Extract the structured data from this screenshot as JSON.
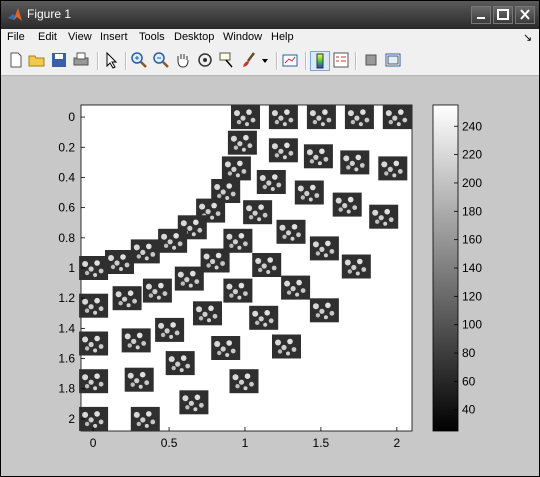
{
  "window": {
    "title": "Figure 1"
  },
  "menu": {
    "items": [
      "File",
      "Edit",
      "View",
      "Insert",
      "Tools",
      "Desktop",
      "Window",
      "Help"
    ],
    "arrow": "↘"
  },
  "toolbar": {
    "icons": [
      "new-figure-icon",
      "open-file-icon",
      "save-icon",
      "print-icon",
      "select-pointer-icon",
      "zoom-in-icon",
      "zoom-out-icon",
      "pan-hand-icon",
      "rotate-3d-icon",
      "data-cursor-icon",
      "brush-icon",
      "brush-dropdown-icon",
      "link-plot-icon",
      "colorbar-icon",
      "legend-icon",
      "hide-plot-tools-icon",
      "show-plot-tools-icon"
    ]
  },
  "axes": {
    "xticks": [
      "0",
      "0.5",
      "1",
      "1.5",
      "2"
    ],
    "yticks": [
      "0",
      "0.2",
      "0.4",
      "0.6",
      "0.8",
      "1",
      "1.2",
      "1.4",
      "1.6",
      "1.8",
      "2"
    ],
    "xlim": [
      -0.08,
      2.1
    ],
    "ylim": [
      -0.08,
      2.08
    ],
    "y_reversed": true
  },
  "colorbar": {
    "ticks": [
      "240",
      "220",
      "200",
      "180",
      "160",
      "140",
      "120",
      "100",
      "80",
      "60",
      "40"
    ],
    "values": [
      240,
      220,
      200,
      180,
      160,
      140,
      120,
      100,
      80,
      60,
      40
    ],
    "range": [
      25,
      255
    ],
    "colormap": "gray"
  },
  "chart_data": {
    "type": "scatter",
    "description_of_marks": "image thumbnails",
    "points": [
      {
        "x": 1.0,
        "y": 0.0
      },
      {
        "x": 1.25,
        "y": 0.0
      },
      {
        "x": 1.5,
        "y": 0.0
      },
      {
        "x": 1.75,
        "y": 0.0
      },
      {
        "x": 2.0,
        "y": 0.0
      },
      {
        "x": 0.98,
        "y": 0.17
      },
      {
        "x": 1.25,
        "y": 0.22
      },
      {
        "x": 1.48,
        "y": 0.26
      },
      {
        "x": 1.72,
        "y": 0.3
      },
      {
        "x": 1.97,
        "y": 0.34
      },
      {
        "x": 0.94,
        "y": 0.34
      },
      {
        "x": 1.17,
        "y": 0.43
      },
      {
        "x": 1.42,
        "y": 0.5
      },
      {
        "x": 1.67,
        "y": 0.58
      },
      {
        "x": 1.91,
        "y": 0.66
      },
      {
        "x": 0.87,
        "y": 0.49
      },
      {
        "x": 1.08,
        "y": 0.63
      },
      {
        "x": 1.3,
        "y": 0.76
      },
      {
        "x": 1.52,
        "y": 0.87
      },
      {
        "x": 1.73,
        "y": 0.99
      },
      {
        "x": 0.77,
        "y": 0.62
      },
      {
        "x": 0.95,
        "y": 0.82
      },
      {
        "x": 1.14,
        "y": 0.98
      },
      {
        "x": 1.33,
        "y": 1.13
      },
      {
        "x": 1.52,
        "y": 1.28
      },
      {
        "x": 0.65,
        "y": 0.73
      },
      {
        "x": 0.8,
        "y": 0.95
      },
      {
        "x": 0.95,
        "y": 1.15
      },
      {
        "x": 1.12,
        "y": 1.33
      },
      {
        "x": 1.27,
        "y": 1.52
      },
      {
        "x": 0.52,
        "y": 0.82
      },
      {
        "x": 0.63,
        "y": 1.07
      },
      {
        "x": 0.75,
        "y": 1.3
      },
      {
        "x": 0.87,
        "y": 1.53
      },
      {
        "x": 0.99,
        "y": 1.75
      },
      {
        "x": 0.34,
        "y": 0.89
      },
      {
        "x": 0.42,
        "y": 1.15
      },
      {
        "x": 0.5,
        "y": 1.41
      },
      {
        "x": 0.57,
        "y": 1.63
      },
      {
        "x": 0.66,
        "y": 1.89
      },
      {
        "x": 0.17,
        "y": 0.96
      },
      {
        "x": 0.22,
        "y": 1.2
      },
      {
        "x": 0.28,
        "y": 1.48
      },
      {
        "x": 0.3,
        "y": 1.74
      },
      {
        "x": 0.34,
        "y": 2.0
      },
      {
        "x": 0.0,
        "y": 1.0
      },
      {
        "x": 0.0,
        "y": 1.25
      },
      {
        "x": 0.0,
        "y": 1.5
      },
      {
        "x": 0.0,
        "y": 1.75
      },
      {
        "x": 0.0,
        "y": 2.0
      }
    ]
  }
}
